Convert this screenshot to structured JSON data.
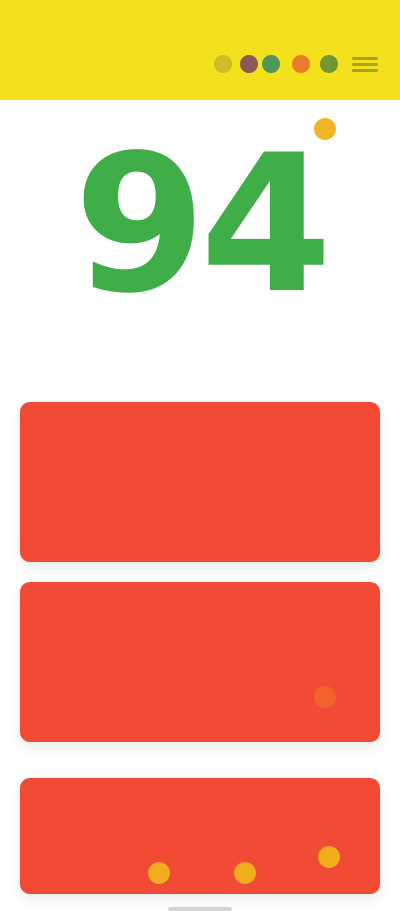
{
  "header": {
    "brand": "",
    "status_right": ""
  },
  "score": {
    "value": "94",
    "subtitle": ""
  },
  "cards": [
    {
      "title": "",
      "left_key": "",
      "left_value": "",
      "mid_key": "",
      "mid_value": ""
    },
    {
      "title": "",
      "left_key": "",
      "left_value": "",
      "mid_key": "",
      "mid_value": ""
    },
    {
      "left_block": "",
      "mini1": "",
      "mini2": "",
      "mini3": ""
    }
  ],
  "colors": {
    "header_bg": "#f4e11e",
    "score_green": "#3fae49",
    "card_red": "#f24b35",
    "indicator_yellow": "#f0b21a",
    "indicator_orange": "#f06a2b"
  },
  "icons": {
    "menu": "menu-icon",
    "language_dots": [
      "language-flag-icon",
      "language-flag-icon",
      "language-flag-icon",
      "language-flag-icon",
      "language-flag-icon"
    ]
  }
}
